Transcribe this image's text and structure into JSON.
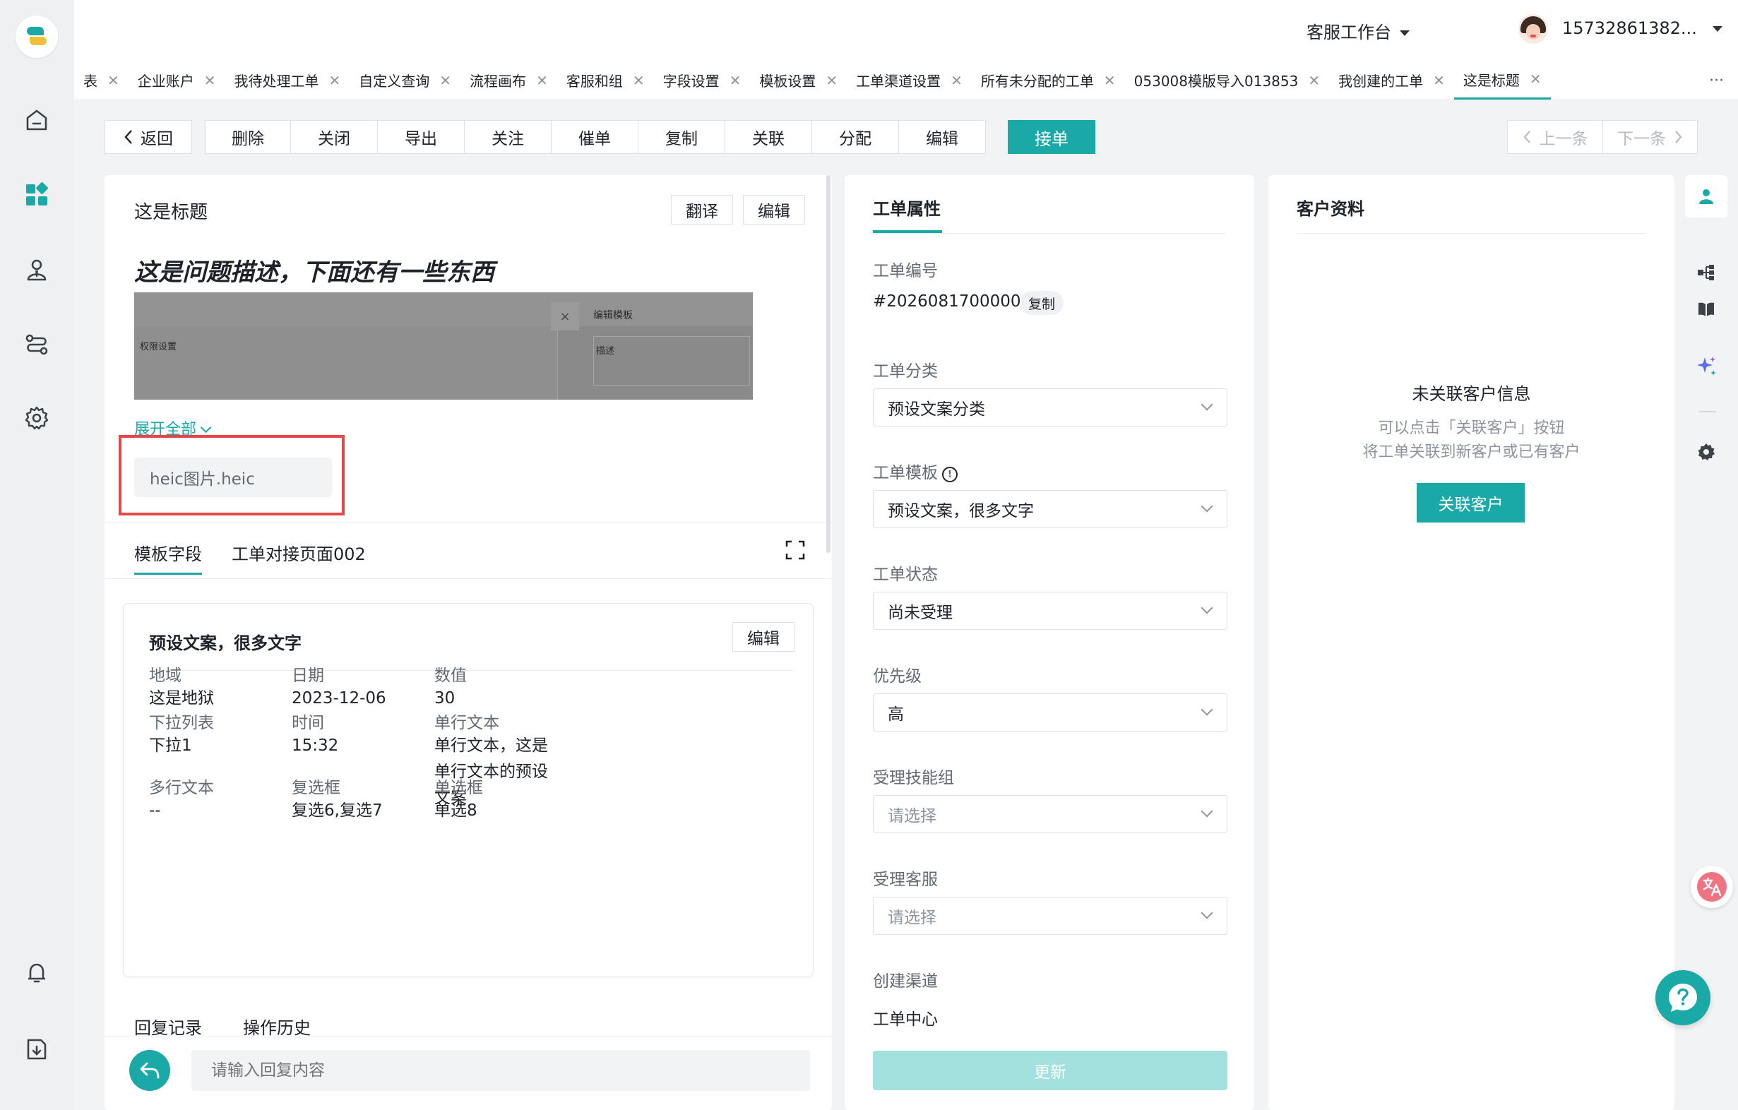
{
  "header": {
    "workspace": "客服工作台",
    "username": "15732861382..."
  },
  "tabs": [
    {
      "label": "表",
      "active": false
    },
    {
      "label": "企业账户",
      "active": false
    },
    {
      "label": "我待处理工单",
      "active": false
    },
    {
      "label": "自定义查询",
      "active": false
    },
    {
      "label": "流程画布",
      "active": false
    },
    {
      "label": "客服和组",
      "active": false
    },
    {
      "label": "字段设置",
      "active": false
    },
    {
      "label": "模板设置",
      "active": false
    },
    {
      "label": "工单渠道设置",
      "active": false
    },
    {
      "label": "所有未分配的工单",
      "active": false
    },
    {
      "label": "053008模版导入013853",
      "active": false
    },
    {
      "label": "我创建的工单",
      "active": false
    },
    {
      "label": "这是标题",
      "active": true
    }
  ],
  "tab_close": "✕",
  "tab_more": "···",
  "toolbar": {
    "back": "返回",
    "actions": [
      "删除",
      "关闭",
      "导出",
      "关注",
      "催单",
      "复制",
      "关联",
      "分配",
      "编辑"
    ],
    "accept": "接单",
    "prev": "上一条",
    "next": "下一条"
  },
  "ticket": {
    "title": "这是标题",
    "translate": "翻译",
    "edit": "编辑",
    "description": "这是问题描述，下面还有一些东西",
    "screenshot": {
      "left_label": "权限设置",
      "right_title": "编辑模板",
      "right_field": "描述",
      "close": "×"
    },
    "expand_all": "展开全部",
    "attachment": "heic图片.heic",
    "subtabs": [
      "模板字段",
      "工单对接页面002"
    ],
    "template_card": {
      "title": "预设文案，很多文字",
      "edit": "编辑",
      "fields": [
        {
          "label": "地域",
          "value": "这是地狱"
        },
        {
          "label": "日期",
          "value": "2023-12-06"
        },
        {
          "label": "数值",
          "value": "30"
        },
        {
          "label": "下拉列表",
          "value": "下拉1"
        },
        {
          "label": "时间",
          "value": "15:32"
        },
        {
          "label": "单行文本",
          "value": "单行文本，这是单行文本的预设文案"
        },
        {
          "label": "多行文本",
          "value": "--"
        },
        {
          "label": "复选框",
          "value": "复选6,复选7"
        },
        {
          "label": "单选框",
          "value": "单选8"
        }
      ]
    },
    "bottom_tabs": [
      "回复记录",
      "操作历史"
    ],
    "reply_placeholder": "请输入回复内容"
  },
  "properties": {
    "heading": "工单属性",
    "number_label": "工单编号",
    "number_value": "#20260817000001",
    "copy": "复制",
    "category_label": "工单分类",
    "category_value": "预设文案分类",
    "template_label": "工单模板",
    "template_value": "预设文案，很多文字",
    "status_label": "工单状态",
    "status_value": "尚未受理",
    "priority_label": "优先级",
    "priority_value": "高",
    "skill_label": "受理技能组",
    "skill_placeholder": "请选择",
    "agent_label": "受理客服",
    "agent_placeholder": "请选择",
    "channel_label": "创建渠道",
    "channel_value": "工单中心",
    "update": "更新"
  },
  "customer": {
    "heading": "客户资料",
    "empty_title": "未关联客户信息",
    "empty_line1": "可以点击「关联客户」按钮",
    "empty_line2": "将工单关联到新客户或已有客户",
    "link_button": "关联客户"
  },
  "colors": {
    "accent": "#1aa9a6",
    "highlight": "#e5474b"
  }
}
